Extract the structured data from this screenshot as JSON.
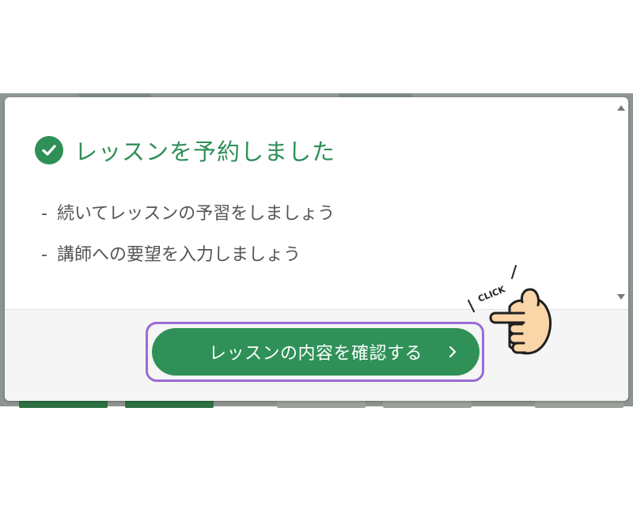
{
  "dialog": {
    "title": "レッスンを予約しました",
    "items": [
      {
        "dash": "-",
        "text": "続いてレッスンの予習をしましょう"
      },
      {
        "dash": "-",
        "text": "講師への要望を入力しましょう"
      }
    ],
    "primary_button": {
      "label": "レッスンの内容を確認する",
      "icon": "chevron-right-icon"
    }
  },
  "annotation": {
    "text": "CLICK",
    "icon": "pointing-hand-icon"
  },
  "colors": {
    "accent": "#2e8f57",
    "button": "#2f9158",
    "focus_ring": "#9b6ad6",
    "text": "#555555",
    "footer": "#f4f5f4",
    "hand": "#f9d5a7"
  }
}
